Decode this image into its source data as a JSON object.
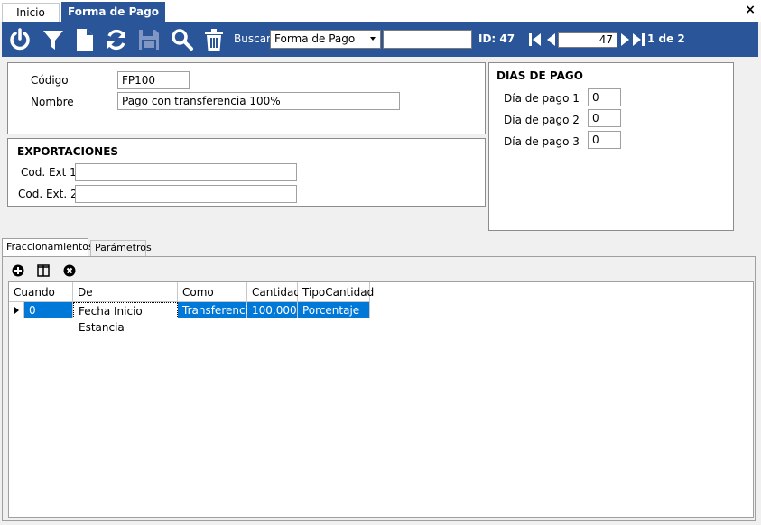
{
  "tabs_top": {
    "home": "Inicio",
    "active": "Forma de Pago",
    "close": "×"
  },
  "toolbar": {
    "icons": [
      "power-icon",
      "filter-icon",
      "new-document-icon",
      "refresh-icon",
      "save-icon",
      "search-icon",
      "delete-icon"
    ],
    "search_label": "Buscar",
    "search_select": "Forma de Pago",
    "search_value": "",
    "id_label": "ID: 47",
    "record_number": "47",
    "page_label": "1 de 2"
  },
  "general": {
    "codigo_label": "Código",
    "codigo_value": "FP100",
    "nombre_label": "Nombre",
    "nombre_value": "Pago con transferencia 100%"
  },
  "exportaciones": {
    "title": "EXPORTACIONES",
    "ext1_label": "Cod. Ext 1",
    "ext1_value": "",
    "ext2_label": "Cod. Ext. 2",
    "ext2_value": ""
  },
  "dias_pago": {
    "title": "DIAS DE PAGO",
    "items": [
      {
        "label": "Día de pago 1",
        "value": "0"
      },
      {
        "label": "Día de pago 2",
        "value": "0"
      },
      {
        "label": "Día de pago 3",
        "value": "0"
      }
    ]
  },
  "lower_tabs": {
    "active": "Fraccionamientos",
    "inactive": "Parámetros"
  },
  "grid": {
    "toolbar_icons": [
      "add-circle-icon",
      "columns-icon",
      "remove-circle-icon"
    ],
    "columns": [
      "Cuando",
      "De",
      "Como",
      "Cantidad",
      "TipoCantidad"
    ],
    "rows": [
      {
        "cuando": "0",
        "de": "Fecha Inicio Estancia",
        "como": "Transferencia",
        "cantidad": "100,000",
        "tipo": "Porcentaje"
      }
    ]
  },
  "colors": {
    "toolbar_bg": "#2a5699",
    "selection": "#0078d7"
  }
}
